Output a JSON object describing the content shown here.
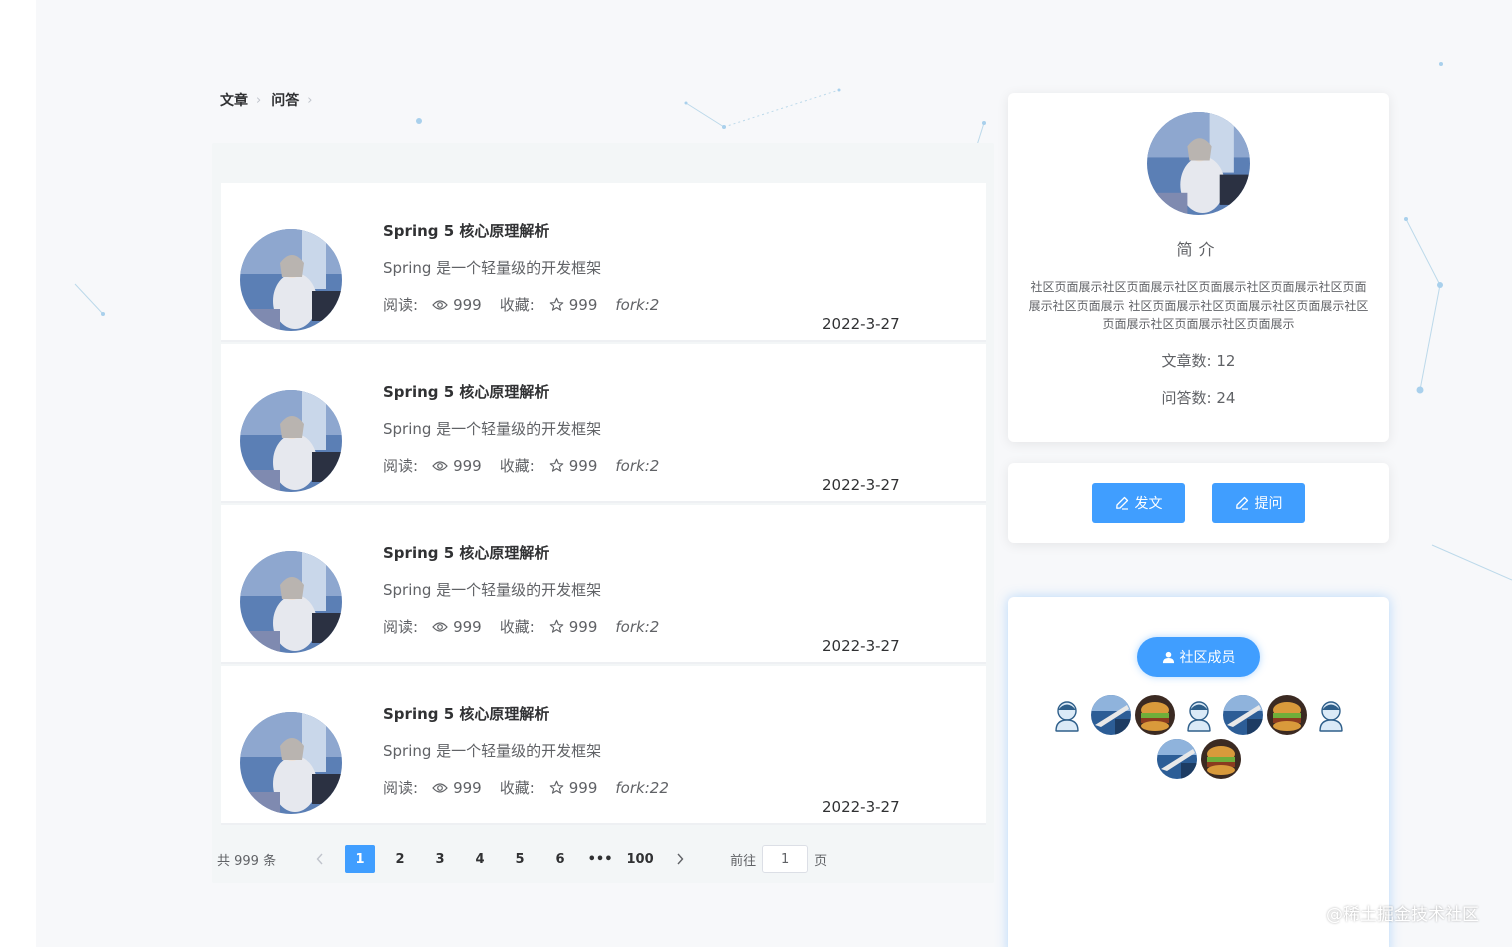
{
  "breadcrumb": [
    {
      "label": "文章"
    },
    {
      "label": "问答"
    }
  ],
  "articles": [
    {
      "title": "Spring 5 核心原理解析",
      "desc": "Spring 是一个轻量级的开发框架",
      "read_label": "阅读:",
      "reads": "999",
      "fav_label": "收藏:",
      "favs": "999",
      "fork": "fork:2",
      "date": "2022-3-27"
    },
    {
      "title": "Spring 5 核心原理解析",
      "desc": "Spring 是一个轻量级的开发框架",
      "read_label": "阅读:",
      "reads": "999",
      "fav_label": "收藏:",
      "favs": "999",
      "fork": "fork:2",
      "date": "2022-3-27"
    },
    {
      "title": "Spring 5 核心原理解析",
      "desc": "Spring 是一个轻量级的开发框架",
      "read_label": "阅读:",
      "reads": "999",
      "fav_label": "收藏:",
      "favs": "999",
      "fork": "fork:2",
      "date": "2022-3-27"
    },
    {
      "title": "Spring 5 核心原理解析",
      "desc": "Spring 是一个轻量级的开发框架",
      "read_label": "阅读:",
      "reads": "999",
      "fav_label": "收藏:",
      "favs": "999",
      "fork": "fork:22",
      "date": "2022-3-27"
    }
  ],
  "pagination": {
    "total_text": "共 999 条",
    "pages": [
      "1",
      "2",
      "3",
      "4",
      "5",
      "6",
      "•••",
      "100"
    ],
    "current": "1",
    "goto_prefix": "前往",
    "goto_value": "1",
    "goto_suffix": "页"
  },
  "profile": {
    "title": "简介",
    "desc": "社区页面展示社区页面展示社区页面展示社区页面展示社区页面展示社区页面展示 社区页面展示社区页面展示社区页面展示社区页面展示社区页面展示社区页面展示",
    "articles_label": "文章数:",
    "articles_count": "12",
    "qa_label": "问答数:",
    "qa_count": "24"
  },
  "actions": {
    "post_label": "发文",
    "ask_label": "提问"
  },
  "members": {
    "button_label": "社区成员",
    "avatars": [
      "girl-avatar",
      "plane-avatar",
      "burger-avatar",
      "girl-avatar",
      "plane-avatar",
      "burger-avatar",
      "girl-avatar",
      "plane-avatar",
      "burger-avatar"
    ]
  },
  "watermark": "@稀土掘金技术社区",
  "colors": {
    "primary": "#409eff",
    "background": "#f7f8fa",
    "text": "#303133",
    "muted": "#606266"
  }
}
